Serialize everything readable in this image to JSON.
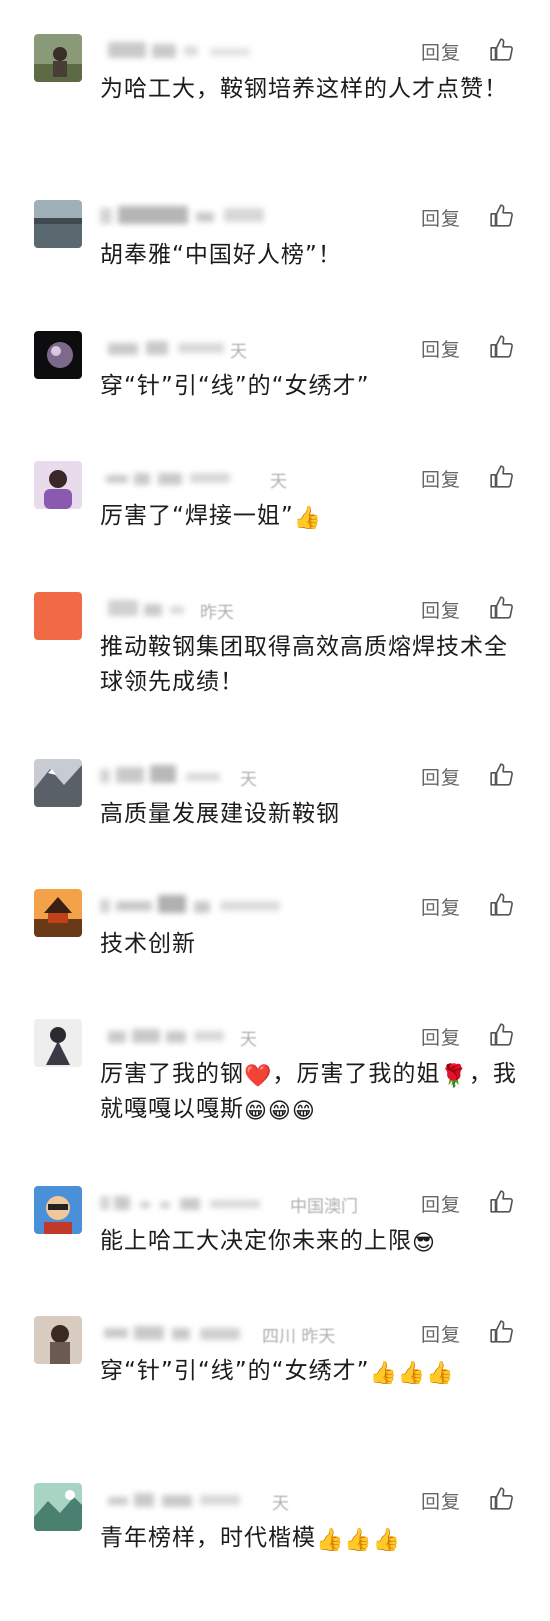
{
  "actions": {
    "reply_label": "回复"
  },
  "comments": [
    {
      "content": "为哈工大，鞍钢培养这样的人才点赞！",
      "meta": ""
    },
    {
      "content": "胡奉雅“中国好人榜”！",
      "meta": ""
    },
    {
      "content": "穿“针”引“线”的“女绣才”",
      "meta": "天"
    },
    {
      "content": "厉害了“焊接一姐”",
      "emoji": "👍",
      "meta": "天"
    },
    {
      "content": "推动鞍钢集团取得高效高质熔焊技术全球领先成绩！",
      "meta": "昨天"
    },
    {
      "content": "高质量发展建设新鞍钢",
      "meta": "天"
    },
    {
      "content": "技术创新",
      "meta": ""
    },
    {
      "content_a": "厉害了我的钢",
      "emoji_a": "❤️",
      "content_b": "，厉害了我的姐",
      "emoji_b": "🌹",
      "content_c": "，我就嘎嘎以嘎斯",
      "emoji_c": "😁😁😁",
      "meta": "天"
    },
    {
      "content": "能上哈工大决定你未来的上限",
      "emoji": "😎",
      "meta": "中国澳门"
    },
    {
      "content": "穿“针”引“线”的“女绣才”",
      "emoji": "👍👍👍",
      "meta": "四川 昨天"
    },
    {
      "content": "青年榜样，时代楷模",
      "emoji": "👍👍👍",
      "meta": "天"
    }
  ]
}
